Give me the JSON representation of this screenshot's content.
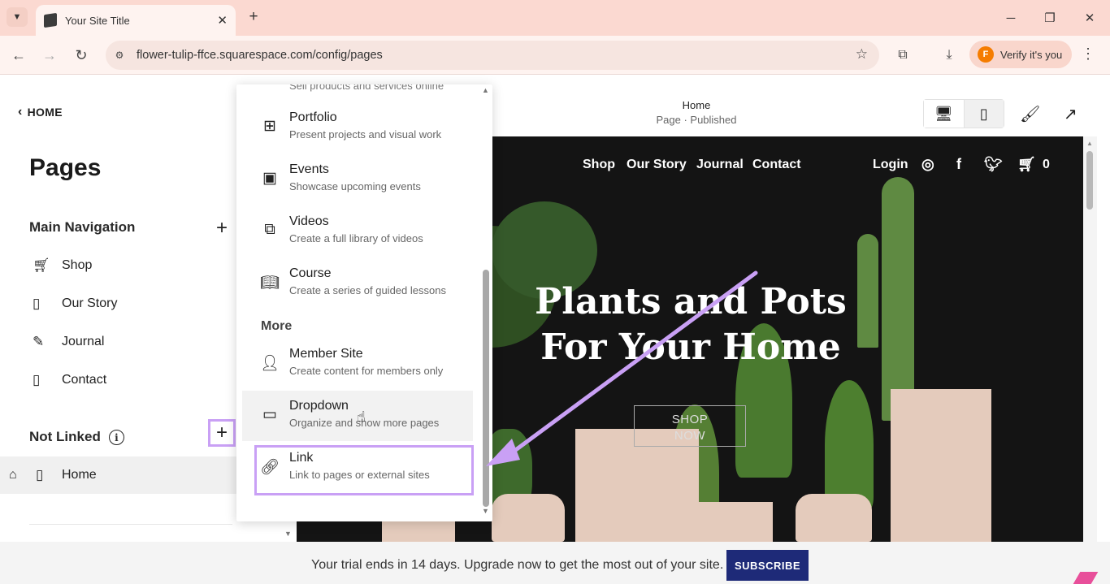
{
  "browser": {
    "tab_title": "Your Site Title",
    "url": "flower-tulip-ffce.squarespace.com/config/pages",
    "verify_label": "Verify it's you",
    "profile_initial": "F"
  },
  "left_panel": {
    "back_label": "HOME",
    "title": "Pages",
    "main_nav_title": "Main Navigation",
    "main_nav_items": [
      {
        "label": "Shop",
        "icon": "cart-icon"
      },
      {
        "label": "Our Story",
        "icon": "page-icon"
      },
      {
        "label": "Journal",
        "icon": "blog-icon"
      },
      {
        "label": "Contact",
        "icon": "page-icon"
      }
    ],
    "not_linked_title": "Not Linked",
    "not_linked_items": [
      {
        "label": "Home",
        "icon": "page-icon"
      }
    ]
  },
  "preview": {
    "page_title": "Home",
    "page_status": "Page · Published"
  },
  "site": {
    "nav": [
      "Shop",
      "Our Story",
      "Journal",
      "Contact"
    ],
    "login": "Login",
    "cart_count": "0",
    "hero_line1": "Plants and Pots",
    "hero_line2": "For Your Home",
    "cta_line1": "SHOP",
    "cta_line2": "NOW"
  },
  "menu": {
    "cut_text": "Sell products and services online",
    "items": [
      {
        "title": "Portfolio",
        "desc": "Present projects and visual work",
        "icon": "grid-icon"
      },
      {
        "title": "Events",
        "desc": "Showcase upcoming events",
        "icon": "calendar-icon"
      },
      {
        "title": "Videos",
        "desc": "Create a full library of videos",
        "icon": "video-icon"
      },
      {
        "title": "Course",
        "desc": "Create a series of guided lessons",
        "icon": "book-icon"
      }
    ],
    "section_more": "More",
    "more_items": [
      {
        "title": "Member Site",
        "desc": "Create content for members only",
        "icon": "member-lock-icon"
      },
      {
        "title": "Dropdown",
        "desc": "Organize and show more pages",
        "icon": "dropdown-icon"
      },
      {
        "title": "Link",
        "desc": "Link to pages or external sites",
        "icon": "link-icon"
      }
    ]
  },
  "trial_banner": {
    "text": "Your trial ends in 14 days. Upgrade now to get the most out of your site.",
    "button": "SUBSCRIBE"
  },
  "colors": {
    "highlight": "#c9a0f5",
    "subscribe_bg": "#1e2a78",
    "tabbar_bg": "#fbd9d1"
  }
}
